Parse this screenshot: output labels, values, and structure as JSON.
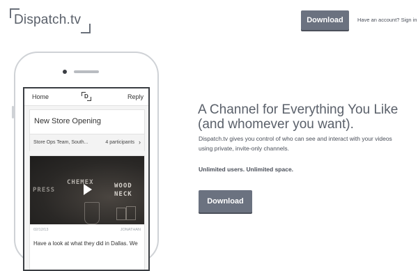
{
  "header": {
    "logo_text": "Dispatch.tv",
    "download_label": "Download",
    "account_text": "Have an account?",
    "signin_label": "Sign in"
  },
  "phone": {
    "app_bar": {
      "home": "Home",
      "logo_letter": "D",
      "reply": "Reply"
    },
    "channel": {
      "title": "New Store Opening",
      "team": "Store Ops Team, South...",
      "participants": "4 participants",
      "chevron": "›"
    },
    "post": {
      "image_words": [
        "PRESS",
        "CHEMEX",
        "WOOD",
        "NECK"
      ],
      "date": "02/12/13",
      "author": "JONATHAN",
      "text": "Have a look at what they did in Dallas. We"
    }
  },
  "hero": {
    "headline": "A Channel for Everything You Like (and whomever you want).",
    "body": "Dispatch.tv gives you control of who can see and interact with your videos using private, invite-only channels.",
    "tagline": "Unlimited users. Unlimited space.",
    "download_label": "Download"
  },
  "colors": {
    "button": "#6b7280",
    "text": "#4a4f59",
    "headline": "#5a606a"
  },
  "icons": [
    "play-icon",
    "chevron-right-icon"
  ]
}
